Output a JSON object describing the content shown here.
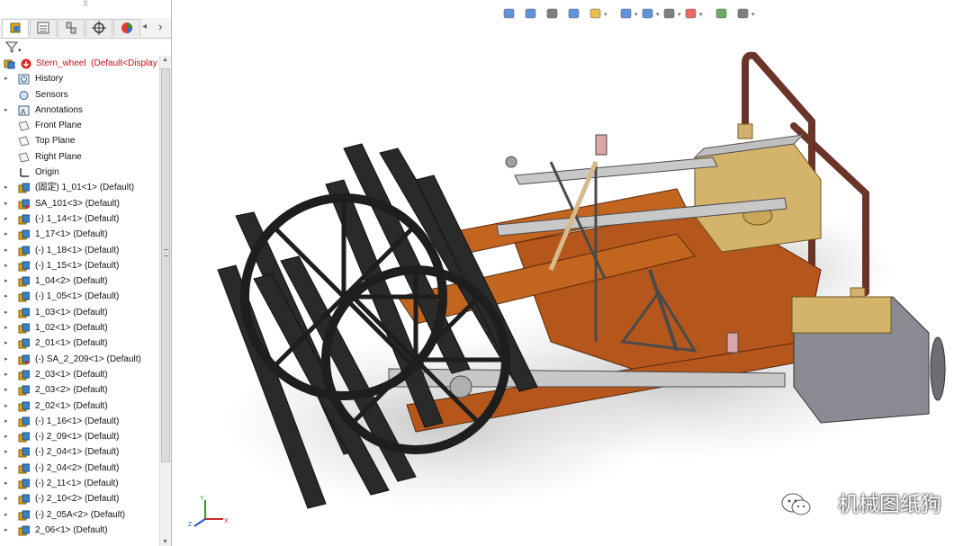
{
  "feature_tree": {
    "root": {
      "name": "Stern_wheel",
      "config": "(Default<Display"
    },
    "items": [
      {
        "label": "History",
        "icon": "history-icon",
        "expandable": true
      },
      {
        "label": "Sensors",
        "icon": "sensors-icon",
        "expandable": false
      },
      {
        "label": "Annotations",
        "icon": "annotations-icon",
        "expandable": true
      },
      {
        "label": "Front Plane",
        "icon": "plane-icon",
        "expandable": false
      },
      {
        "label": "Top Plane",
        "icon": "plane-icon",
        "expandable": false
      },
      {
        "label": "Right Plane",
        "icon": "plane-icon",
        "expandable": false
      },
      {
        "label": "Origin",
        "icon": "origin-icon",
        "expandable": false
      },
      {
        "label": "(固定) 1_01<1> (Default)",
        "icon": "part-icon",
        "expandable": true
      },
      {
        "label": "SA_101<3> (Default)",
        "icon": "subassembly-icon",
        "expandable": true
      },
      {
        "label": "(-) 1_14<1> (Default)",
        "icon": "part-icon",
        "expandable": true
      },
      {
        "label": "1_17<1> (Default)",
        "icon": "part-icon",
        "expandable": true
      },
      {
        "label": "(-) 1_18<1> (Default)",
        "icon": "part-icon",
        "expandable": true
      },
      {
        "label": "(-) 1_15<1> (Default)",
        "icon": "part-icon",
        "expandable": true
      },
      {
        "label": "1_04<2> (Default)",
        "icon": "part-icon",
        "expandable": true
      },
      {
        "label": "(-) 1_05<1> (Default)",
        "icon": "part-icon",
        "expandable": true
      },
      {
        "label": "1_03<1> (Default)",
        "icon": "part-icon",
        "expandable": true
      },
      {
        "label": "1_02<1> (Default)",
        "icon": "part-icon",
        "expandable": true
      },
      {
        "label": "2_01<1> (Default)",
        "icon": "part-icon",
        "expandable": true
      },
      {
        "label": "(-) SA_2_209<1> (Default)",
        "icon": "subassembly-icon",
        "expandable": true
      },
      {
        "label": "2_03<1> (Default)",
        "icon": "part-icon",
        "expandable": true
      },
      {
        "label": "2_03<2> (Default)",
        "icon": "part-icon",
        "expandable": true
      },
      {
        "label": "2_02<1> (Default)",
        "icon": "part-icon",
        "expandable": true
      },
      {
        "label": "(-) 1_16<1> (Default)",
        "icon": "part-icon",
        "expandable": true
      },
      {
        "label": "(-) 2_09<1> (Default)",
        "icon": "part-icon",
        "expandable": true
      },
      {
        "label": "(-) 2_04<1> (Default)",
        "icon": "part-icon",
        "expandable": true
      },
      {
        "label": "(-) 2_04<2> (Default)",
        "icon": "part-icon",
        "expandable": true
      },
      {
        "label": "(-) 2_11<1> (Default)",
        "icon": "part-icon",
        "expandable": true
      },
      {
        "label": "(-) 2_10<2> (Default)",
        "icon": "part-icon",
        "expandable": true
      },
      {
        "label": "(-) 2_05A<2> (Default)",
        "icon": "part-icon",
        "expandable": true
      },
      {
        "label": "2_06<1> (Default)",
        "icon": "part-icon",
        "expandable": true
      }
    ]
  },
  "tabs": [
    "featuremanager-tab",
    "propertymanager-tab",
    "configurationmanager-tab",
    "dimxpert-tab",
    "display-manager-tab"
  ],
  "toolbar_icons": [
    "zoom-to-fit-icon",
    "zoom-to-area-icon",
    "previous-view-icon",
    "section-view-icon",
    "dynamic-annotation-icon",
    "view-orientation-icon",
    "display-style-icon",
    "hide-show-icon",
    "edit-appearance-icon",
    "apply-scene-icon",
    "view-settings-icon"
  ],
  "watermark": {
    "text": "机械图纸狗"
  },
  "colors": {
    "root_label": "#c4101a",
    "wheel": "#2a2a2a",
    "frame": "#b5561c",
    "brass": "#d4b46a",
    "cylinder": "#8a8a92"
  }
}
